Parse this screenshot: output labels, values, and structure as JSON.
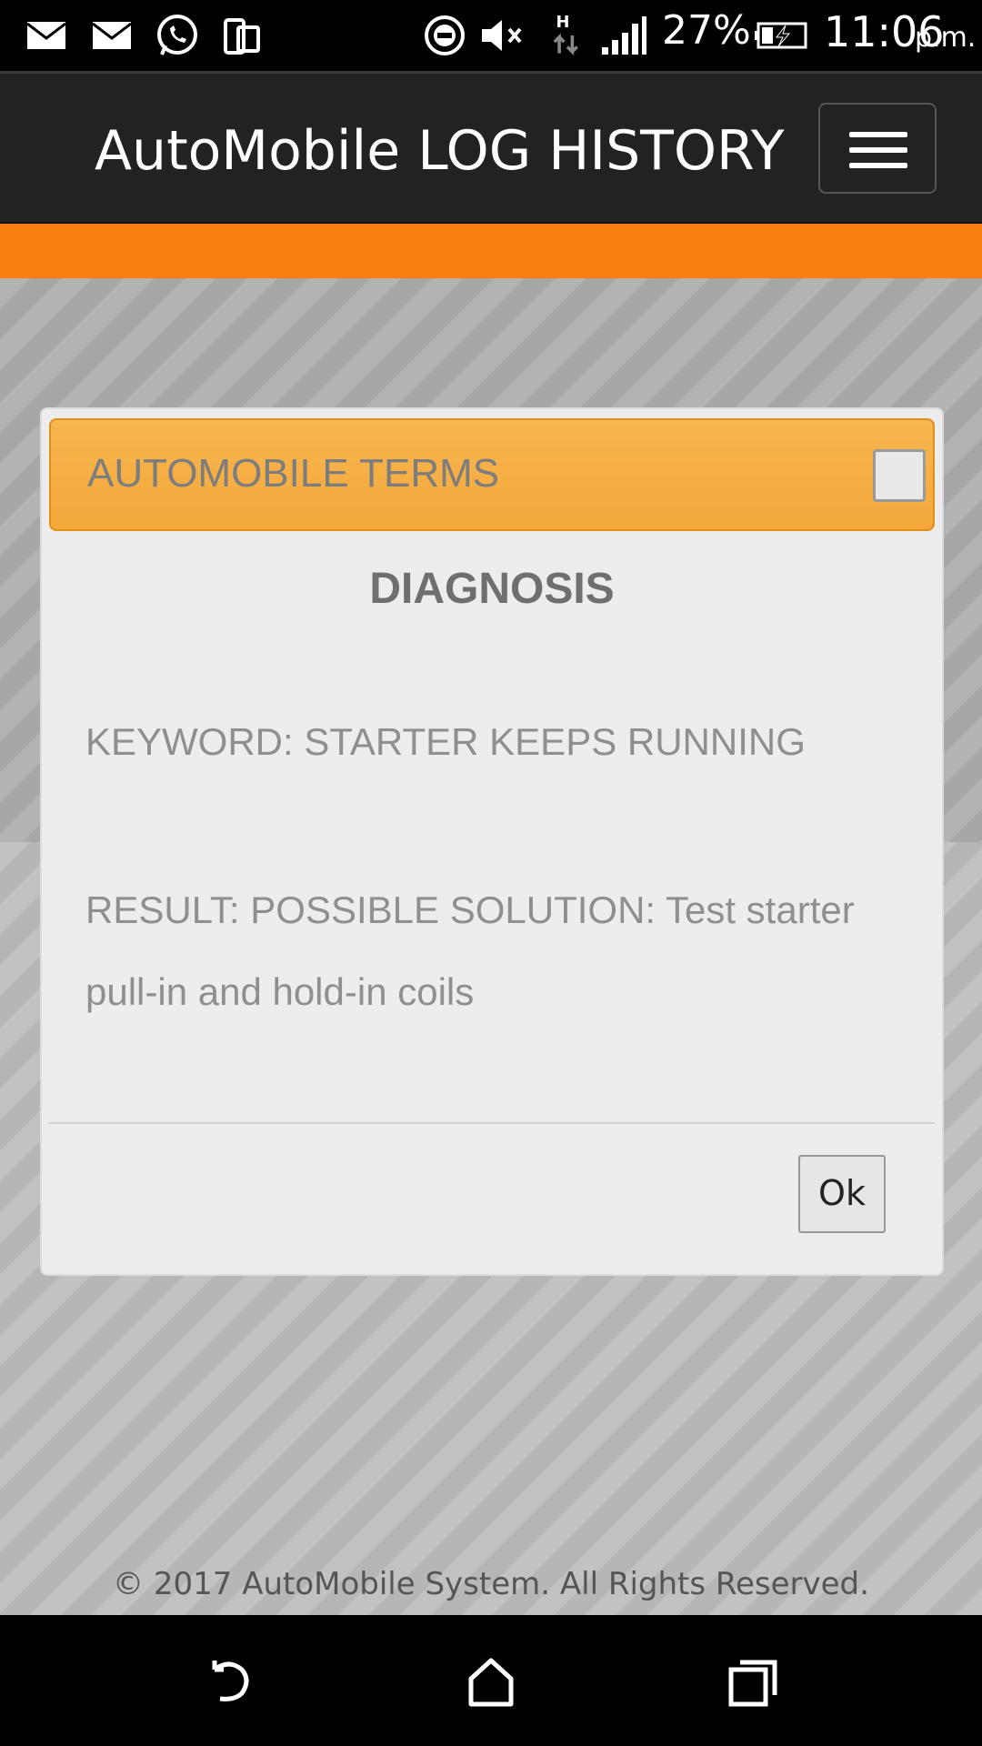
{
  "status_bar": {
    "icons": [
      "mail-icon",
      "mail-icon",
      "whatsapp-icon",
      "screen-mirror-icon",
      "do-not-disturb-icon",
      "muted-icon",
      "h-data-icon",
      "signal-icon",
      "battery-charging-icon"
    ],
    "battery": "27%",
    "time": "11:06",
    "ampm": "p.m.",
    "network_type": "H",
    "battery_level": 0.27
  },
  "header": {
    "title": "AutoMobile LOG HISTORY",
    "menu_icon": "hamburger-icon"
  },
  "colors": {
    "header_bg": "#222222",
    "accent_orange": "#f8800f",
    "dialog_header": "#f4a83a"
  },
  "dialog": {
    "header_title": "AUTOMOBILE TERMS",
    "checkbox_checked": false,
    "subtitle": "DIAGNOSIS",
    "keyword_text": "KEYWORD: STARTER KEEPS RUNNING",
    "result_text": "RESULT: POSSIBLE SOLUTION: Test starter pull-in and hold-in coils",
    "ok_label": "Ok"
  },
  "footer": {
    "text": "© 2017 AutoMobile System. All Rights Reserved."
  },
  "nav_bar": {
    "buttons": [
      "back-icon",
      "home-icon",
      "recent-apps-icon"
    ]
  }
}
